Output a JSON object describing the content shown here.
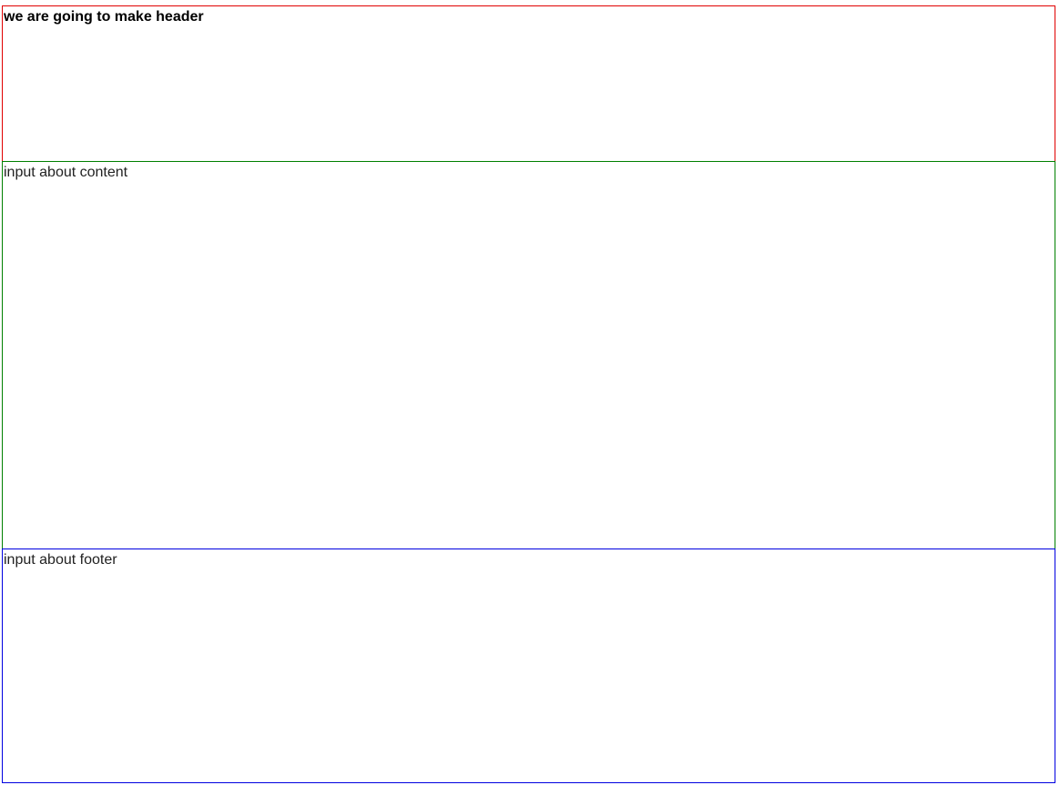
{
  "header": {
    "text": "we are going to make header",
    "border_color": "#e00000"
  },
  "content": {
    "text": "input about content",
    "border_color": "#008000"
  },
  "footer": {
    "text": "input about footer",
    "border_color": "#0000e0"
  }
}
